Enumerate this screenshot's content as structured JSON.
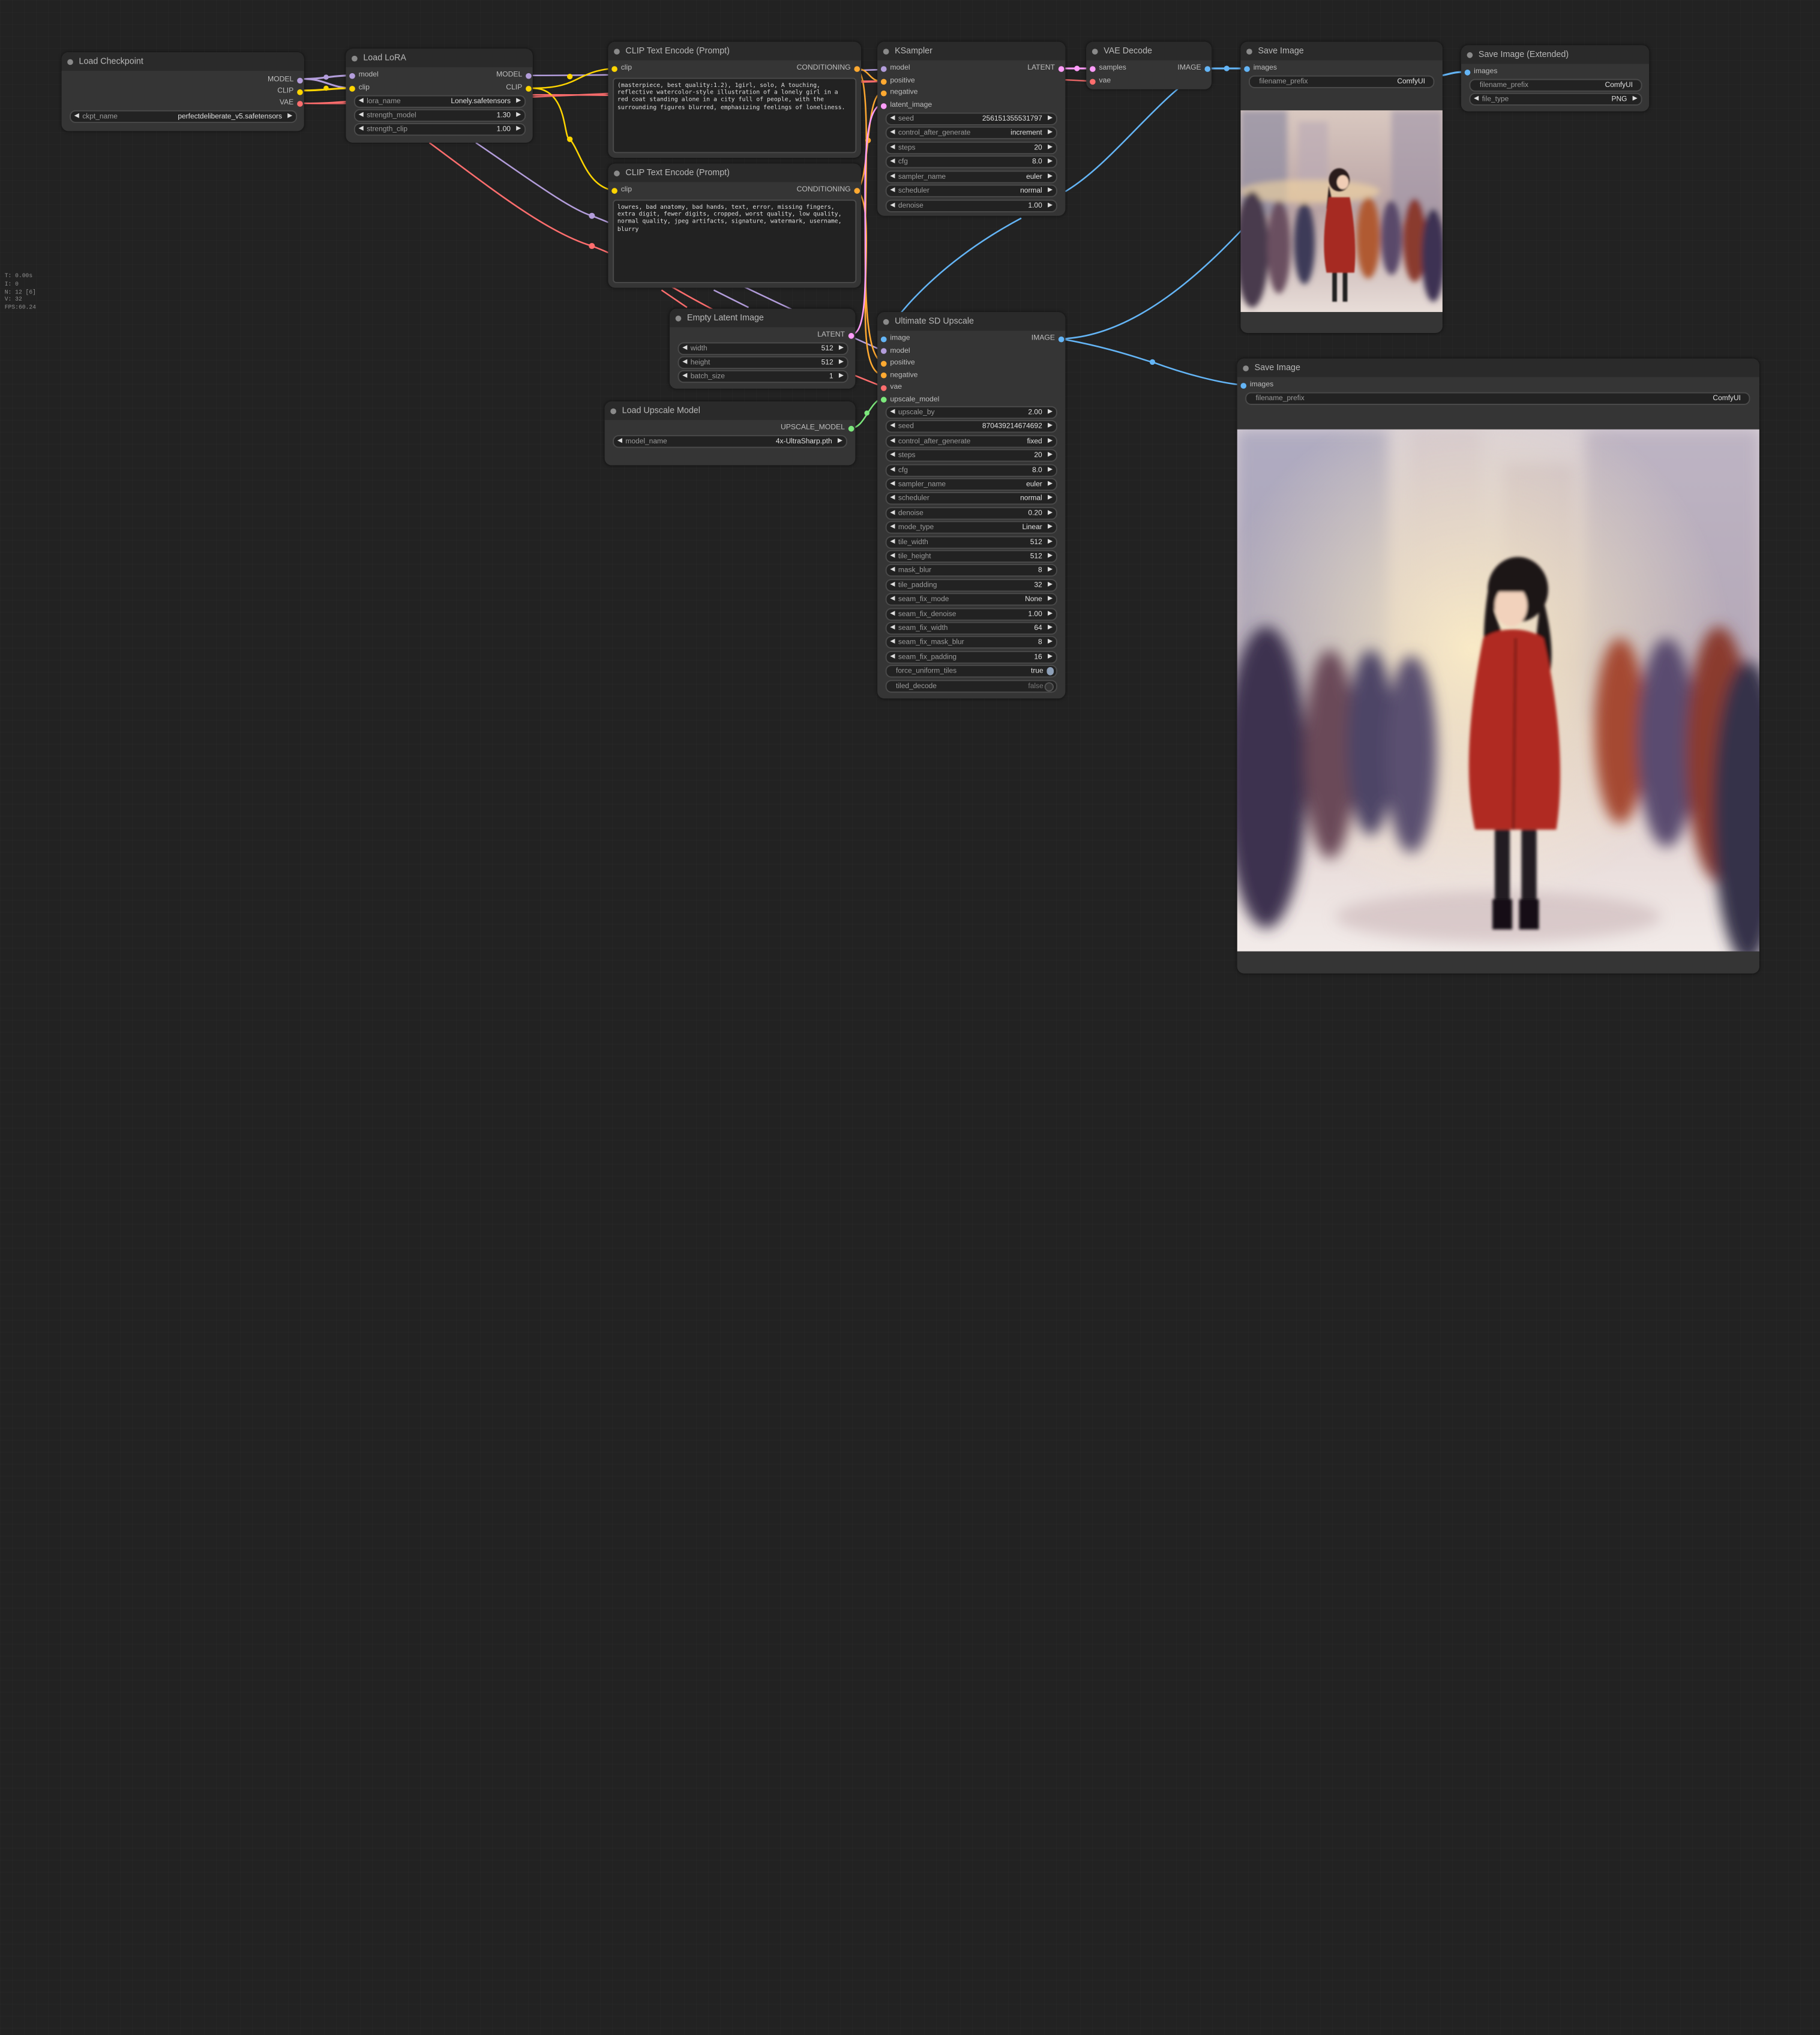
{
  "stats": {
    "t": "T: 0.00s",
    "i": "I: 0",
    "n": "N: 12 [6]",
    "v": "V: 32",
    "fps": "FPS:60.24"
  },
  "nodes": {
    "load_checkpoint": {
      "title": "Load Checkpoint",
      "out_model": "MODEL",
      "out_clip": "CLIP",
      "out_vae": "VAE",
      "ckpt_label": "ckpt_name",
      "ckpt_value": "perfectdeliberate_v5.safetensors"
    },
    "load_lora": {
      "title": "Load LoRA",
      "in_model": "model",
      "in_clip": "clip",
      "out_model": "MODEL",
      "out_clip": "CLIP",
      "lora_label": "lora_name",
      "lora_value": "Lonely.safetensors",
      "sm_label": "strength_model",
      "sm_value": "1.30",
      "sc_label": "strength_clip",
      "sc_value": "1.00"
    },
    "clip_pos": {
      "title": "CLIP Text Encode (Prompt)",
      "in_clip": "clip",
      "out": "CONDITIONING",
      "text": "(masterpiece, best quality:1.2), 1girl, solo, A touching, reflective watercolor-style illustration of a lonely girl in a red coat standing alone in a city full of people, with the surrounding figures blurred, emphasizing feelings of loneliness."
    },
    "clip_neg": {
      "title": "CLIP Text Encode (Prompt)",
      "in_clip": "clip",
      "out": "CONDITIONING",
      "text": "lowres, bad anatomy, bad hands, text, error, missing fingers, extra digit, fewer digits, cropped, worst quality, low quality, normal quality, jpeg artifacts, signature, watermark, username, blurry"
    },
    "empty_latent": {
      "title": "Empty Latent Image",
      "out": "LATENT",
      "w_label": "width",
      "w_value": "512",
      "h_label": "height",
      "h_value": "512",
      "b_label": "batch_size",
      "b_value": "1"
    },
    "load_upscale": {
      "title": "Load Upscale Model",
      "out": "UPSCALE_MODEL",
      "m_label": "model_name",
      "m_value": "4x-UltraSharp.pth"
    },
    "ksampler": {
      "title": "KSampler",
      "in_model": "model",
      "in_pos": "positive",
      "in_neg": "negative",
      "in_latent": "latent_image",
      "out": "LATENT",
      "widgets": [
        {
          "label": "seed",
          "value": "256151355531797"
        },
        {
          "label": "control_after_generate",
          "value": "increment"
        },
        {
          "label": "steps",
          "value": "20"
        },
        {
          "label": "cfg",
          "value": "8.0"
        },
        {
          "label": "sampler_name",
          "value": "euler"
        },
        {
          "label": "scheduler",
          "value": "normal"
        },
        {
          "label": "denoise",
          "value": "1.00"
        }
      ]
    },
    "vae_decode": {
      "title": "VAE Decode",
      "in_samples": "samples",
      "in_vae": "vae",
      "out": "IMAGE"
    },
    "save1": {
      "title": "Save Image",
      "in_images": "images",
      "fp_label": "filename_prefix",
      "fp_value": "ComfyUI"
    },
    "save_ext": {
      "title": "Save Image (Extended)",
      "in_images": "images",
      "fp_label": "filename_prefix",
      "fp_value": "ComfyUI",
      "ft_label": "file_type",
      "ft_value": "PNG"
    },
    "usd": {
      "title": "Ultimate SD Upscale",
      "in_image": "image",
      "in_model": "model",
      "in_pos": "positive",
      "in_neg": "negative",
      "in_vae": "vae",
      "in_upm": "upscale_model",
      "out": "IMAGE",
      "widgets": [
        {
          "label": "upscale_by",
          "value": "2.00"
        },
        {
          "label": "seed",
          "value": "870439214674692"
        },
        {
          "label": "control_after_generate",
          "value": "fixed"
        },
        {
          "label": "steps",
          "value": "20"
        },
        {
          "label": "cfg",
          "value": "8.0"
        },
        {
          "label": "sampler_name",
          "value": "euler"
        },
        {
          "label": "scheduler",
          "value": "normal"
        },
        {
          "label": "denoise",
          "value": "0.20"
        },
        {
          "label": "mode_type",
          "value": "Linear"
        },
        {
          "label": "tile_width",
          "value": "512"
        },
        {
          "label": "tile_height",
          "value": "512"
        },
        {
          "label": "mask_blur",
          "value": "8"
        },
        {
          "label": "tile_padding",
          "value": "32"
        },
        {
          "label": "seam_fix_mode",
          "value": "None"
        },
        {
          "label": "seam_fix_denoise",
          "value": "1.00"
        },
        {
          "label": "seam_fix_width",
          "value": "64"
        },
        {
          "label": "seam_fix_mask_blur",
          "value": "8"
        },
        {
          "label": "seam_fix_padding",
          "value": "16"
        }
      ],
      "toggles": [
        {
          "label": "force_uniform_tiles",
          "value": "true"
        },
        {
          "label": "tiled_decode",
          "value": "false"
        }
      ]
    },
    "save2": {
      "title": "Save Image",
      "in_images": "images",
      "fp_label": "filename_prefix",
      "fp_value": "ComfyUI"
    }
  },
  "colors": {
    "model": "#b39ddb",
    "clip": "#ffd500",
    "vae": "#ff6e6e",
    "conditioning": "#ffa931",
    "latent": "#ff9cf9",
    "image": "#64b5f6",
    "upscale_model": "#7ce87c"
  }
}
